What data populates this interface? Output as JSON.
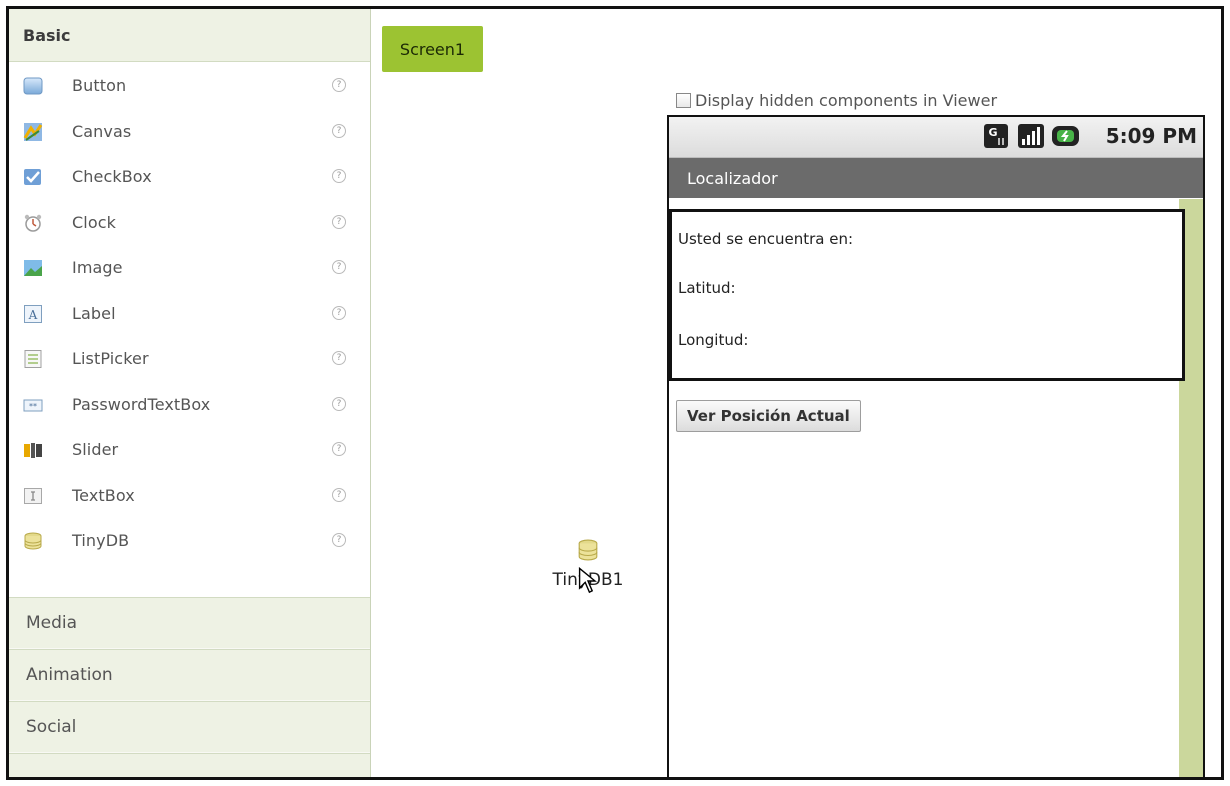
{
  "palette": {
    "section": "Basic",
    "items": [
      {
        "label": "Button",
        "icon": "button-icon"
      },
      {
        "label": "Canvas",
        "icon": "canvas-icon"
      },
      {
        "label": "CheckBox",
        "icon": "checkbox-icon"
      },
      {
        "label": "Clock",
        "icon": "clock-icon"
      },
      {
        "label": "Image",
        "icon": "image-icon"
      },
      {
        "label": "Label",
        "icon": "label-icon"
      },
      {
        "label": "ListPicker",
        "icon": "listpicker-icon"
      },
      {
        "label": "PasswordTextBox",
        "icon": "passwordtextbox-icon"
      },
      {
        "label": "Slider",
        "icon": "slider-icon"
      },
      {
        "label": "TextBox",
        "icon": "textbox-icon"
      },
      {
        "label": "TinyDB",
        "icon": "tinydb-icon"
      }
    ],
    "help_glyph": "?",
    "categories": [
      "Media",
      "Animation",
      "Social"
    ]
  },
  "viewer": {
    "screen_tab": "Screen1",
    "hidden_checkbox_label": "Display hidden components in Viewer",
    "status_time": "5:09 PM",
    "app_title": "Localizador",
    "labels": {
      "location": "Usted se encuentra en:",
      "latitude": "Latitud:",
      "longitude": "Longitud:"
    },
    "button_label": "Ver Posición Actual"
  },
  "nonvisible": {
    "component": "TinyDB1"
  },
  "colors": {
    "accent": "#9cc332",
    "palette_header": "#eef2e4",
    "titlebar": "#6b6b6b",
    "scrollbar": "#cbd79c"
  }
}
